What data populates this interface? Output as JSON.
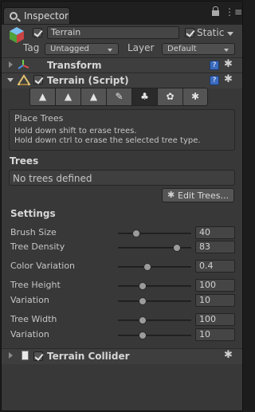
{
  "window": {
    "tab_label": "Inspector"
  },
  "object": {
    "name": "Terrain",
    "static_label": "Static",
    "tag_label": "Tag",
    "tag_value": "Untagged",
    "layer_label": "Layer",
    "layer_value": "Default"
  },
  "components": {
    "transform": "Transform",
    "terrain_script": "Terrain (Script)",
    "terrain_collider": "Terrain Collider"
  },
  "toolbar": {
    "tools": [
      {
        "name": "raise-lower-tool",
        "glyph": "▲"
      },
      {
        "name": "paint-height-tool",
        "glyph": "▲"
      },
      {
        "name": "smooth-height-tool",
        "glyph": "▲"
      },
      {
        "name": "paint-texture-tool",
        "glyph": "✎"
      },
      {
        "name": "place-trees-tool",
        "glyph": "♣"
      },
      {
        "name": "paint-details-tool",
        "glyph": "✿"
      },
      {
        "name": "settings-tool",
        "glyph": "✱"
      }
    ],
    "selected_index": 4
  },
  "info": {
    "title": "Place Trees",
    "line1": "Hold down shift to erase trees.",
    "line2": "Hold down ctrl to erase the selected tree type."
  },
  "trees": {
    "header": "Trees",
    "empty_text": "No trees defined",
    "edit_button": "Edit Trees..."
  },
  "settings": {
    "header": "Settings",
    "rows": [
      {
        "label": "Brush Size",
        "value": "40",
        "level": 0.25
      },
      {
        "label": "Tree Density",
        "value": "83",
        "level": 0.8
      },
      {
        "label": "Color Variation",
        "value": "0.4",
        "level": 0.4
      },
      {
        "label": "Tree Height",
        "value": "100",
        "level": 0.34
      },
      {
        "label": "Variation",
        "value": "10",
        "level": 0.34
      },
      {
        "label": "Tree Width",
        "value": "100",
        "level": 0.34
      },
      {
        "label": "Variation",
        "value": "10",
        "level": 0.34
      }
    ]
  },
  "colors": {
    "background": "#383838",
    "tab_bar": "#1f1f1f",
    "help_icon": "#3b6bbf"
  }
}
